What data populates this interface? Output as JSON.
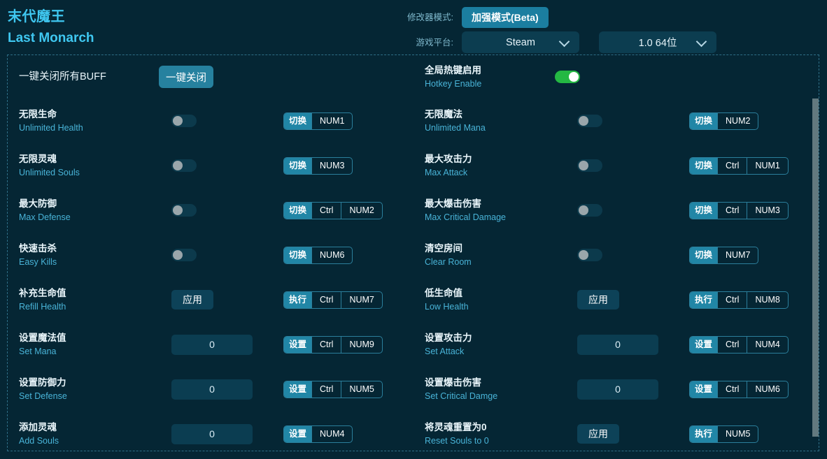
{
  "app": {
    "title_cn": "末代魔王",
    "title_en": "Last Monarch"
  },
  "header": {
    "mode_label": "修改器模式:",
    "mode_value": "加强模式(Beta)",
    "platform_label": "游戏平台:",
    "platform_value": "Steam",
    "version_value": "1.0 64位",
    "caret_icon": "chevron-down-icon"
  },
  "master": {
    "close_all_label": "一键关闭所有BUFF",
    "close_all_button": "一键关闭",
    "hotkey_enable_cn": "全局热键启用",
    "hotkey_enable_en": "Hotkey Enable",
    "hotkey_enable_state": "on"
  },
  "cheats": [
    {
      "cn": "无限生命",
      "en": "Unlimited Health",
      "control": "toggle",
      "state": "off",
      "hotkey": {
        "action": "切换",
        "keys": [
          "NUM1"
        ]
      }
    },
    {
      "cn": "无限魔法",
      "en": "Unlimited Mana",
      "control": "toggle",
      "state": "off",
      "hotkey": {
        "action": "切换",
        "keys": [
          "NUM2"
        ]
      }
    },
    {
      "cn": "无限灵魂",
      "en": "Unlimited Souls",
      "control": "toggle",
      "state": "off",
      "hotkey": {
        "action": "切换",
        "keys": [
          "NUM3"
        ]
      }
    },
    {
      "cn": "最大攻击力",
      "en": "Max Attack",
      "control": "toggle",
      "state": "off",
      "hotkey": {
        "action": "切换",
        "keys": [
          "Ctrl",
          "NUM1"
        ]
      }
    },
    {
      "cn": "最大防御",
      "en": "Max Defense",
      "control": "toggle",
      "state": "off",
      "hotkey": {
        "action": "切换",
        "keys": [
          "Ctrl",
          "NUM2"
        ]
      }
    },
    {
      "cn": "最大爆击伤害",
      "en": "Max Critical Damage",
      "control": "toggle",
      "state": "off",
      "hotkey": {
        "action": "切换",
        "keys": [
          "Ctrl",
          "NUM3"
        ]
      }
    },
    {
      "cn": "快速击杀",
      "en": "Easy Kills",
      "control": "toggle",
      "state": "off",
      "hotkey": {
        "action": "切换",
        "keys": [
          "NUM6"
        ]
      }
    },
    {
      "cn": "清空房间",
      "en": "Clear Room",
      "control": "toggle",
      "state": "off",
      "hotkey": {
        "action": "切换",
        "keys": [
          "NUM7"
        ]
      }
    },
    {
      "cn": "补充生命值",
      "en": "Refill Health",
      "control": "button",
      "button_label": "应用",
      "hotkey": {
        "action": "执行",
        "keys": [
          "Ctrl",
          "NUM7"
        ]
      }
    },
    {
      "cn": "低生命值",
      "en": "Low Health",
      "control": "button",
      "button_label": "应用",
      "hotkey": {
        "action": "执行",
        "keys": [
          "Ctrl",
          "NUM8"
        ]
      }
    },
    {
      "cn": "设置魔法值",
      "en": "Set Mana",
      "control": "input",
      "value": "0",
      "hotkey": {
        "action": "设置",
        "keys": [
          "Ctrl",
          "NUM9"
        ]
      }
    },
    {
      "cn": "设置攻击力",
      "en": "Set Attack",
      "control": "input",
      "value": "0",
      "hotkey": {
        "action": "设置",
        "keys": [
          "Ctrl",
          "NUM4"
        ]
      }
    },
    {
      "cn": "设置防御力",
      "en": "Set Defense",
      "control": "input",
      "value": "0",
      "hotkey": {
        "action": "设置",
        "keys": [
          "Ctrl",
          "NUM5"
        ]
      }
    },
    {
      "cn": "设置爆击伤害",
      "en": "Set Critical Damge",
      "control": "input",
      "value": "0",
      "hotkey": {
        "action": "设置",
        "keys": [
          "Ctrl",
          "NUM6"
        ]
      }
    },
    {
      "cn": "添加灵魂",
      "en": "Add Souls",
      "control": "input",
      "value": "0",
      "hotkey": {
        "action": "设置",
        "keys": [
          "NUM4"
        ]
      }
    },
    {
      "cn": "将灵魂重置为0",
      "en": "Reset Souls to 0",
      "control": "button",
      "button_label": "应用",
      "hotkey": {
        "action": "执行",
        "keys": [
          "NUM5"
        ]
      }
    }
  ],
  "colors": {
    "background": "#052634",
    "accent": "#3fc7f0",
    "action_chip": "#2186a6",
    "toggle_on": "#24b843",
    "toggle_off_track": "#0c3a4c",
    "panel_border": "#2e6e86",
    "scrollbar_thumb": "#62797f"
  }
}
